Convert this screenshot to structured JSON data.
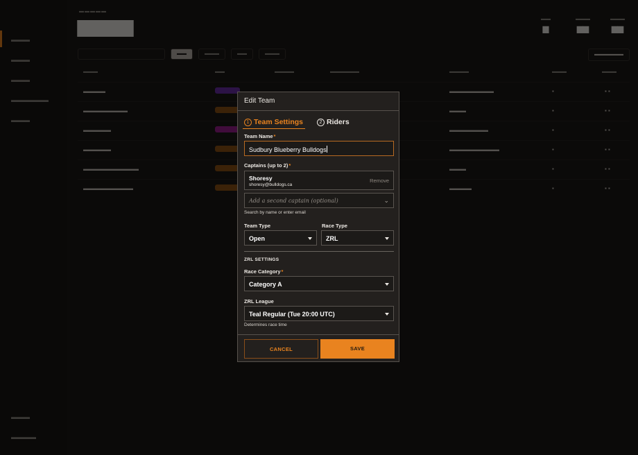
{
  "modal": {
    "title": "Edit Team",
    "tabs": [
      {
        "num": "1",
        "label": "Team Settings",
        "active": true
      },
      {
        "num": "2",
        "label": "Riders",
        "active": false
      }
    ],
    "team_name": {
      "label": "Team Name",
      "required": "*",
      "value": "Sudbury Blueberry Bulldogs"
    },
    "captains": {
      "label": "Captains (up to 2)",
      "required": "*",
      "selected": {
        "name": "Shoresy",
        "email": "shoresy@bulldogs.ca",
        "remove_label": "Remove"
      },
      "add_placeholder": "Add a second captain (optional)",
      "hint": "Search by name or enter email"
    },
    "team_type": {
      "label": "Team Type",
      "value": "Open"
    },
    "race_type": {
      "label": "Race Type",
      "value": "ZRL"
    },
    "zrl_section_label": "ZRL SETTINGS",
    "race_category": {
      "label": "Race Category",
      "required": "*",
      "value": "Category A"
    },
    "zrl_league": {
      "label": "ZRL League",
      "value": "Teal Regular (Tue 20:00 UTC)",
      "hint": "Determines race time"
    },
    "cancel_label": "CANCEL",
    "save_label": "SAVE"
  },
  "colors": {
    "accent": "#e9831f",
    "modal_bg": "#23201e",
    "pill_purple": "#6a2fa8",
    "pill_magenta": "#9a1e8c",
    "pill_orange": "#8c5214"
  }
}
